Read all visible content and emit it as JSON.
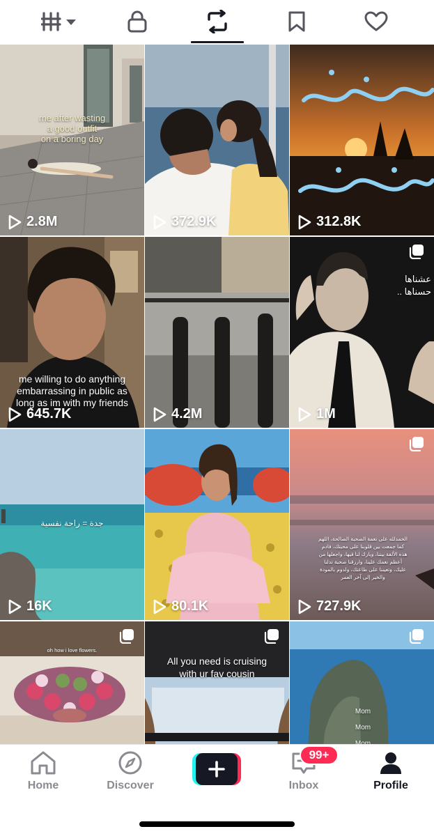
{
  "top_tabs": [
    {
      "icon": "grid-icon",
      "selected": false
    },
    {
      "icon": "lock-icon",
      "selected": false
    },
    {
      "icon": "repost-icon",
      "selected": true
    },
    {
      "icon": "bookmark-icon",
      "selected": false
    },
    {
      "icon": "heart-icon",
      "selected": false
    }
  ],
  "videos": [
    {
      "views": "2.8M",
      "caption": "me after wasting\na good outfit\non a boring day",
      "multi_image": false
    },
    {
      "views": "372.9K",
      "caption": "",
      "multi_image": false
    },
    {
      "views": "312.8K",
      "caption": "",
      "multi_image": false
    },
    {
      "views": "645.7K",
      "caption": "me willing to do anything\nembarrassing in public as\nlong as im with my friends",
      "multi_image": false
    },
    {
      "views": "4.2M",
      "caption": "",
      "multi_image": false
    },
    {
      "views": "1M",
      "caption": "عشناها\nحسناها ..",
      "multi_image": true
    },
    {
      "views": "16K",
      "caption": "جدة = راحة نفسية",
      "multi_image": false
    },
    {
      "views": "80.1K",
      "caption": "",
      "multi_image": false
    },
    {
      "views": "727.9K",
      "caption": "الحمدلله على نعمة الصحبة الصالحة، اللهم كما جمعت بين قلوبنا على محبتك، فادم هذه الألفة بيننا، وبارك لنا فيها، واجعلها من أعظم نعمك علينا، وارزقنا صحبة تدلنا عليك، وتعيننا على طاعتك، ولدوم بالمودة والخير إلى آخر العمر",
      "multi_image": true
    },
    {
      "views": "",
      "caption": "oh how i love flowers.",
      "multi_image": true
    },
    {
      "views": "",
      "caption": "All you need is cruising\nwith ur fav cousin",
      "multi_image": true
    },
    {
      "views": "",
      "caption": "Mom\nMom\nMom",
      "multi_image": true
    }
  ],
  "bottom_nav": {
    "home": "Home",
    "discover": "Discover",
    "inbox": "Inbox",
    "profile": "Profile",
    "inbox_badge": "99+"
  },
  "colors": {
    "accent_red": "#fe2c55",
    "accent_cyan": "#25f4ee",
    "ink": "#161823",
    "inactive": "#8a8b91"
  }
}
